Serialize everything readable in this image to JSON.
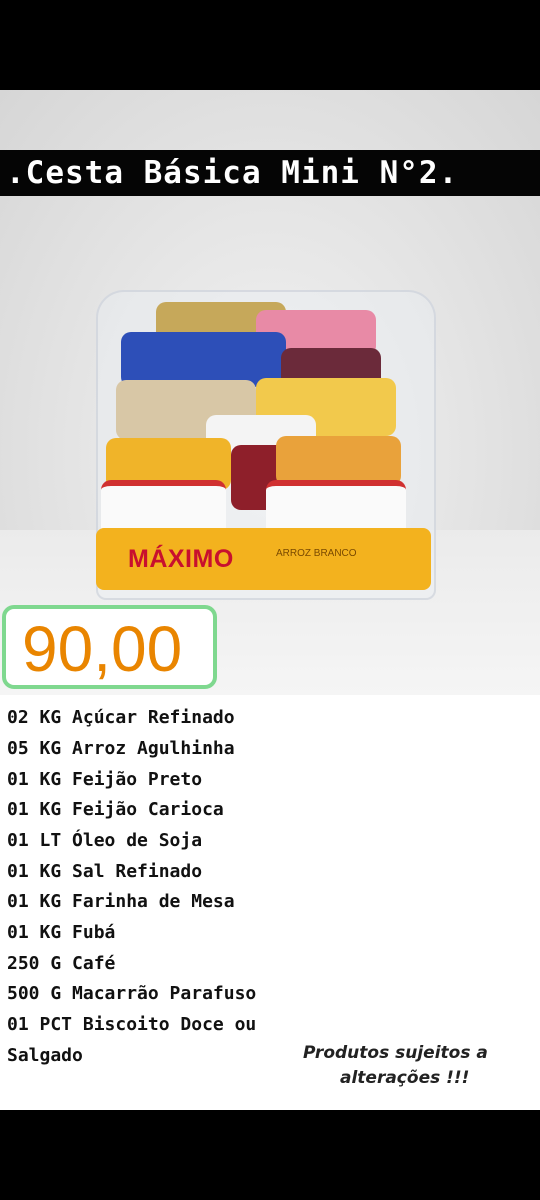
{
  "title": ".Cesta Básica Mini N°2.",
  "price": "90,00",
  "product_labels": {
    "maximo_brand": "MÁXIMO",
    "maximo_product": "ARROZ BRANCO"
  },
  "items": [
    "02 KG Açúcar Refinado",
    "05 KG Arroz Agulhinha",
    "01 KG Feijão Preto",
    "01 KG Feijão Carioca",
    "01 LT Óleo de Soja",
    "01 KG Sal Refinado",
    "01 KG Farinha de Mesa",
    "01 KG Fubá",
    "250 G Café",
    "500 G Macarrão Parafuso",
    "01 PCT Biscoito Doce ou",
    "Salgado"
  ],
  "disclaimer": {
    "line1": "Produtos sujeitos a",
    "line2": "alterações !!!"
  },
  "colors": {
    "price_text": "#e98500",
    "price_border": "#7fd88f",
    "title_band": "#050505"
  }
}
